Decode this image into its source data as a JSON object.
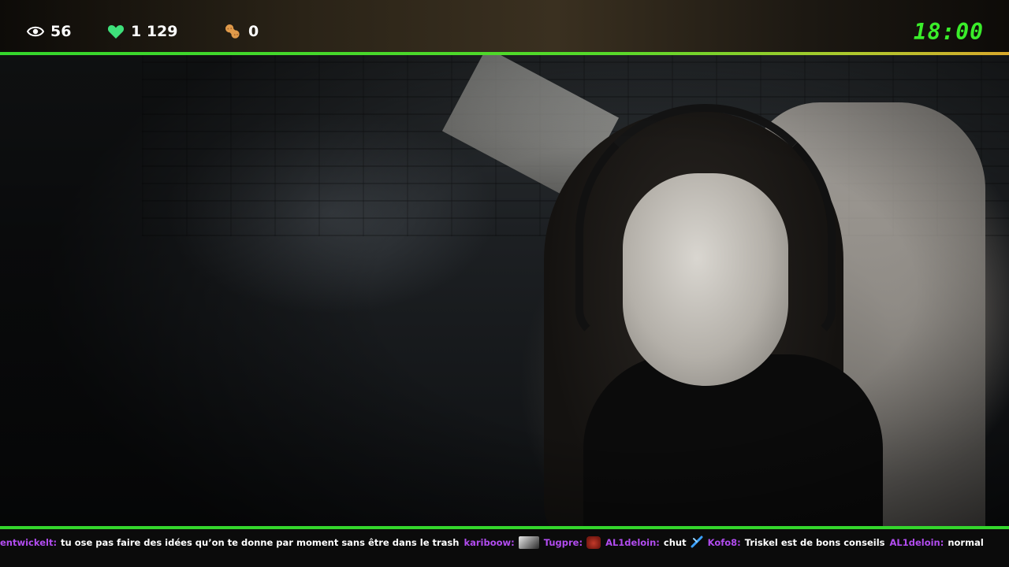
{
  "stats": {
    "viewers": "56",
    "likes": "1 129",
    "peanuts": "0"
  },
  "clock": "18:00",
  "colors": {
    "accent_green": "#34d62c",
    "clock_green": "#3aee2a",
    "username_purple": "#b24cf0",
    "heart_green": "#3ee07a",
    "peanut_orange": "#e09a4a"
  },
  "icons": {
    "viewers": "eye-icon",
    "likes": "heart-icon",
    "peanuts": "peanut-icon"
  },
  "chat": [
    {
      "user": "entwickelt:",
      "text": "tu ose pas faire des idées qu’on te donne par moment sans être dans le trash",
      "emote": null
    },
    {
      "user": "kariboow:",
      "text": "",
      "emote": "image-emote"
    },
    {
      "user": "Tugpre:",
      "text": "",
      "emote": "red-face-emote"
    },
    {
      "user": "AL1deloin:",
      "text": "chut",
      "emote": "blue-cross-emote"
    },
    {
      "user": "Kofo8:",
      "text": "Triskel est de bons conseils",
      "emote": null
    },
    {
      "user": "AL1deloin:",
      "text": "normal",
      "emote": null
    }
  ]
}
